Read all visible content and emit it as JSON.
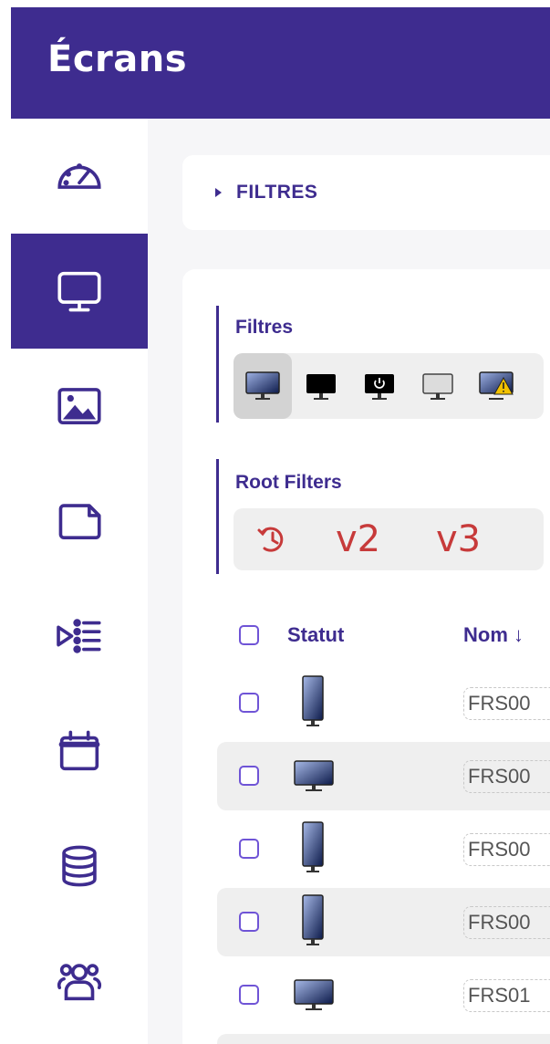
{
  "header": {
    "title": "Écrans"
  },
  "sidebar": {
    "items": [
      {
        "icon": "dashboard-speedometer-icon",
        "active": false
      },
      {
        "icon": "monitor-icon",
        "active": true
      },
      {
        "icon": "image-icon",
        "active": false
      },
      {
        "icon": "folder-page-icon",
        "active": false
      },
      {
        "icon": "playlist-icon",
        "active": false
      },
      {
        "icon": "calendar-icon",
        "active": false
      },
      {
        "icon": "database-icon",
        "active": false
      },
      {
        "icon": "users-group-icon",
        "active": false
      }
    ]
  },
  "filter_bar": {
    "label": "FILTRES"
  },
  "filters_group": {
    "title": "Filtres",
    "status_buttons": [
      {
        "icon": "screen-online-icon",
        "selected": true
      },
      {
        "icon": "screen-black-icon",
        "selected": false
      },
      {
        "icon": "screen-power-icon",
        "selected": false
      },
      {
        "icon": "screen-offline-icon",
        "selected": false
      },
      {
        "icon": "screen-warning-icon",
        "selected": false
      }
    ]
  },
  "root_group": {
    "title": "Root Filters",
    "buttons": [
      {
        "label": "↻",
        "icon": "history-icon"
      },
      {
        "label": "v2"
      },
      {
        "label": "v3"
      }
    ]
  },
  "table": {
    "columns": {
      "status": "Statut",
      "name": "Nom ↓"
    },
    "rows": [
      {
        "orientation": "portrait",
        "name": "FRS00"
      },
      {
        "orientation": "landscape",
        "name": "FRS00"
      },
      {
        "orientation": "portrait",
        "name": "FRS00"
      },
      {
        "orientation": "portrait",
        "name": "FRS00"
      },
      {
        "orientation": "landscape",
        "name": "FRS01"
      }
    ]
  },
  "colors": {
    "brand": "#3e2c8f",
    "accent": "#6f54d6",
    "root_filter": "#c73a3a"
  }
}
